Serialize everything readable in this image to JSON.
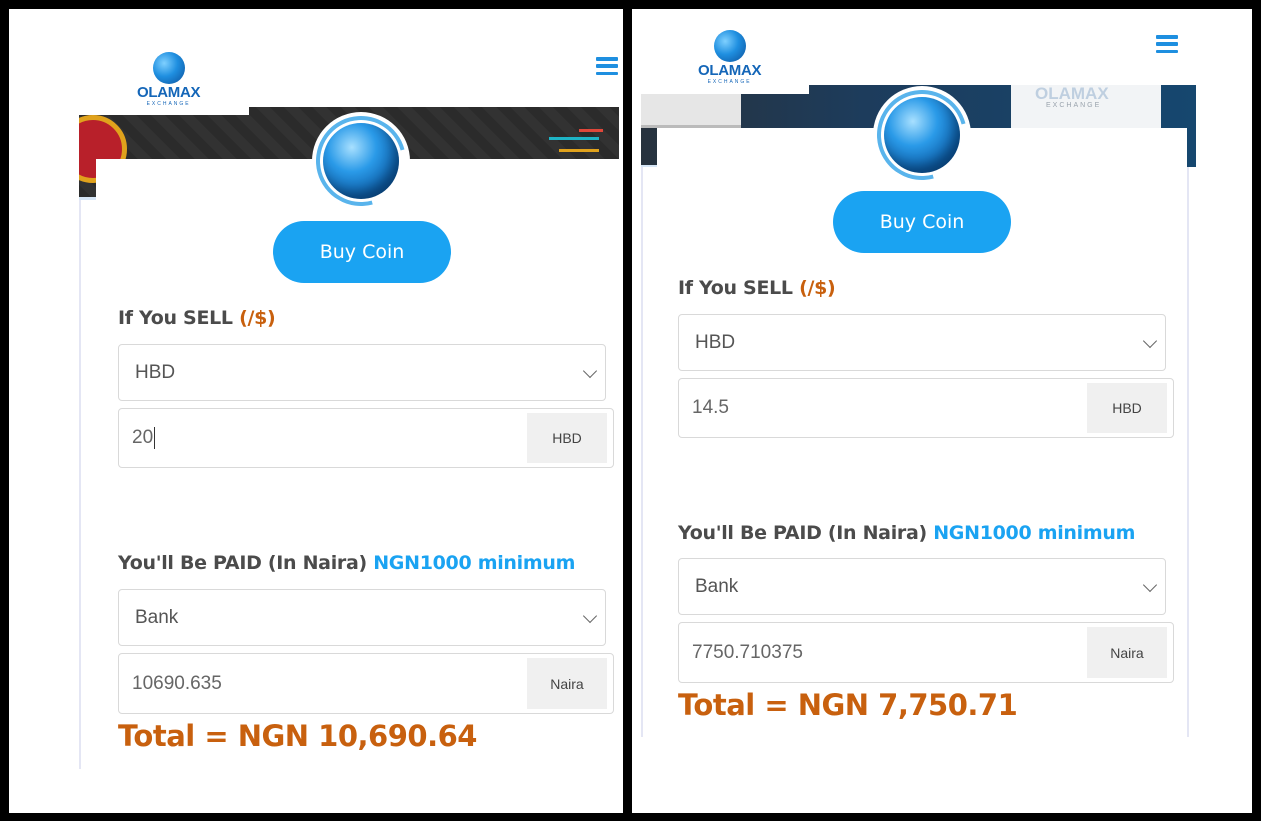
{
  "brand": {
    "name": "OLAMAX",
    "sub": "EXCHANGE"
  },
  "colors": {
    "accent": "#1aa3f2",
    "orange": "#c8600e",
    "label": "#4b4b4b"
  },
  "icons": {
    "menu": "hamburger-menu-icon",
    "dropdown": "chevron-down-icon",
    "avatar": "globe-logo-icon"
  },
  "panels": [
    {
      "buy_button": "Buy Coin",
      "sell_label": "If You SELL ",
      "sell_unit": "(/$)",
      "coin_select": "HBD",
      "amount_value": "20",
      "amount_addon": "HBD",
      "paid_label": "You'll Be PAID (In Naira) ",
      "paid_min": "NGN1000 minimum",
      "method_select": "Bank",
      "naira_value": "10690.635",
      "naira_addon": "Naira",
      "total": "Total = NGN 10,690.64"
    },
    {
      "buy_button": "Buy Coin",
      "sell_label": "If You SELL ",
      "sell_unit": "(/$)",
      "coin_select": "HBD",
      "amount_value": "14.5",
      "amount_addon": "HBD",
      "paid_label": "You'll Be PAID (In Naira) ",
      "paid_min": "NGN1000 minimum",
      "method_select": "Bank",
      "naira_value": "7750.710375",
      "naira_addon": "Naira",
      "total": "Total = NGN 7,750.71",
      "banner_text": "OLAMAX",
      "banner_sub": "EXCHANGE"
    }
  ]
}
